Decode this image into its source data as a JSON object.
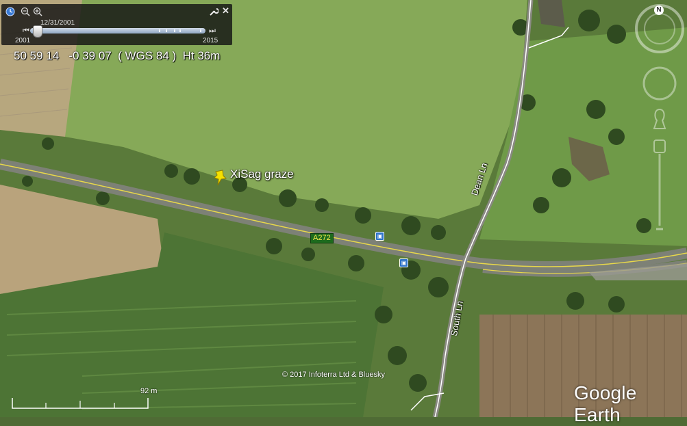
{
  "timebar": {
    "current_date": "12/31/2001",
    "start_year": "2001",
    "end_year": "2015"
  },
  "status": {
    "coordinates": "50 59 14   -0 39 07  ( WGS 84 )  Ht 36m"
  },
  "placemark": {
    "label": "XiSag graze"
  },
  "roads": {
    "a_road": "A272",
    "north_lane": "Dean Ln",
    "south_lane": "South Ln"
  },
  "attribution": "© 2017 Infoterra Ltd & Bluesky",
  "scale": {
    "label": "92 m"
  },
  "logo": "Google Earth",
  "compass": {
    "north_label": "N"
  },
  "colors": {
    "field_light": "#8fb05a",
    "field_dark": "#4a6c30",
    "road_yellow_line": "#e8d84a",
    "road_surface": "#7a7e74",
    "placemark_yellow": "#f5e000",
    "road_label_bg": "#1d6b1d"
  },
  "icons": [
    "history-clock-icon",
    "zoom-out-icon",
    "zoom-in-icon",
    "wrench-icon",
    "close-icon",
    "bus-stop-icon",
    "placemark-pushpin-icon",
    "compass-icon",
    "look-joystick-icon",
    "move-joystick-icon",
    "zoom-slider-icon"
  ]
}
